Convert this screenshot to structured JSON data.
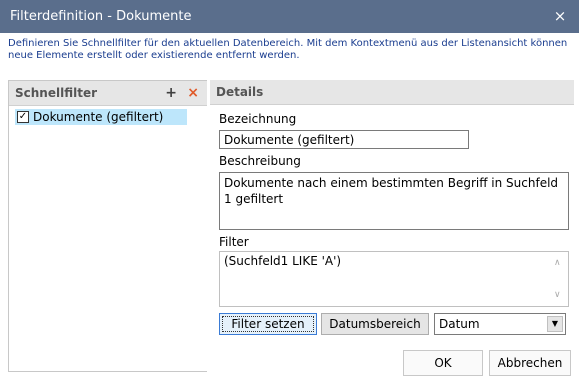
{
  "window": {
    "title": "Filterdefinition - Dokumente",
    "close_glyph": "×"
  },
  "description": "Definieren Sie Schnellfilter für den aktuellen Datenbereich. Mit dem Kontextmenü aus der Listenansicht können neue Elemente erstellt oder existierende entfernt werden.",
  "left_panel": {
    "header": "Schnellfilter",
    "add_glyph": "+",
    "delete_glyph": "×",
    "items": [
      {
        "label": "Dokumente (gefiltert)",
        "checked": true,
        "check_glyph": "✓"
      }
    ]
  },
  "details": {
    "header": "Details",
    "bezeichnung_label": "Bezeichnung",
    "bezeichnung_value": "Dokumente (gefiltert)",
    "beschreibung_label": "Beschreibung",
    "beschreibung_value": "Dokumente nach einem bestimmten Begriff in Suchfeld 1 gefiltert",
    "filter_label": "Filter",
    "filter_value": "(Suchfeld1 LIKE 'A')",
    "scroll_up_glyph": "∧",
    "scroll_down_glyph": "∨",
    "filter_button": "Filter setzen",
    "datumsbereich_button": "Datumsbereich",
    "date_select": "Datum",
    "select_arrow_glyph": "▼"
  },
  "footer": {
    "ok": "OK",
    "cancel": "Abbrechen"
  },
  "colors": {
    "titlebar": "#5a6e8c",
    "selection": "#bde6fb",
    "description_text": "#1a3d8f",
    "delete_icon": "#e05a2a"
  }
}
